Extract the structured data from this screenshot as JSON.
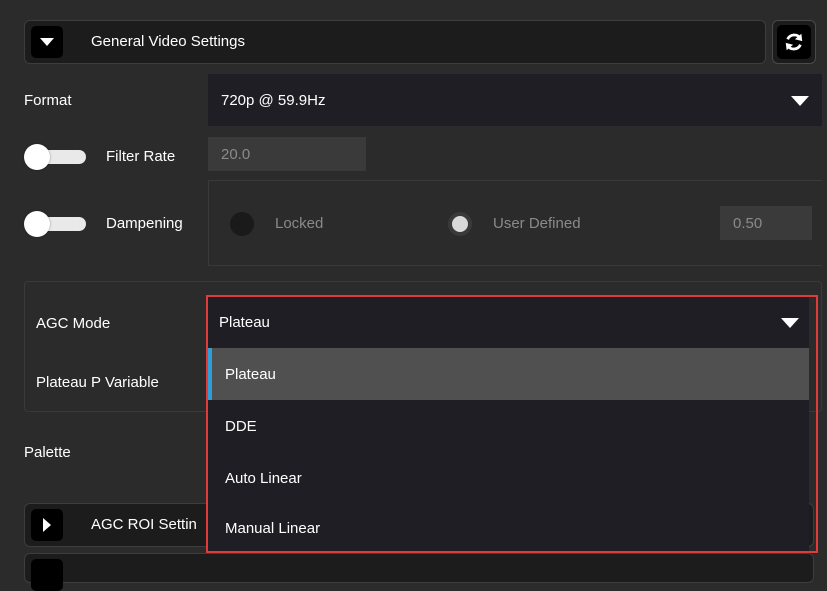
{
  "general": {
    "title": "General Video Settings",
    "icon_toggle": "chevron-down-icon",
    "icon_refresh": "refresh-icon"
  },
  "format": {
    "label": "Format",
    "value": "720p @ 59.9Hz"
  },
  "filter_rate": {
    "label": "Filter Rate",
    "value": "20.0",
    "enabled": false
  },
  "dampening": {
    "label": "Dampening",
    "enabled": false,
    "options": [
      {
        "label": "Locked",
        "selected": false
      },
      {
        "label": "User Defined",
        "selected": true
      }
    ],
    "value": "0.50"
  },
  "agc": {
    "mode_label": "AGC Mode",
    "mode_value": "Plateau",
    "plateau_label": "Plateau P Variable",
    "dropdown_items": [
      {
        "label": "Plateau",
        "selected": true
      },
      {
        "label": "DDE",
        "selected": false
      },
      {
        "label": "Auto Linear",
        "selected": false
      },
      {
        "label": "Manual Linear",
        "selected": false
      }
    ]
  },
  "palette": {
    "label": "Palette"
  },
  "agc_roi": {
    "title": "AGC ROI Settin",
    "icon_toggle": "chevron-right-icon"
  },
  "colors": {
    "background": "#2b2b2b",
    "highlight_border": "#e03a3a",
    "selected_indicator": "#2aa0d8"
  }
}
